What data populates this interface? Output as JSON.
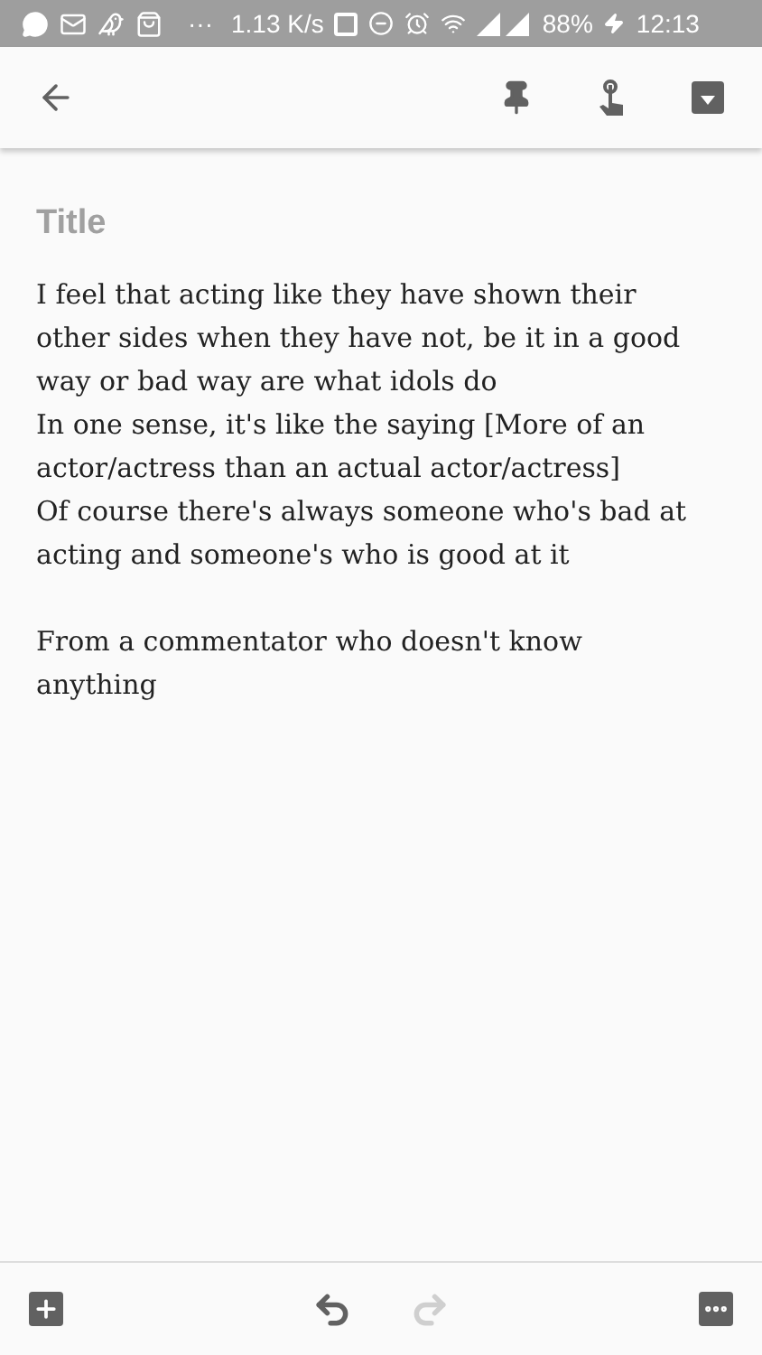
{
  "status_bar": {
    "speed": "1.13 K/s",
    "battery": "88%",
    "time": "12:13",
    "dots": "···"
  },
  "note": {
    "title_placeholder": "Title",
    "paragraphs": [
      "I feel that acting like they have shown their other sides when they have not, be it in a good way or bad way are what idols do",
      "In one sense, it's like the saying [More of an actor/actress than an actual actor/actress]",
      "Of course there's always someone who's bad at acting and someone's who is good at it"
    ],
    "closing": "From a commentator who doesn't know anything"
  },
  "bottom_bar": {
    "undo": {
      "disabled": false
    },
    "redo": {
      "disabled": true
    }
  }
}
